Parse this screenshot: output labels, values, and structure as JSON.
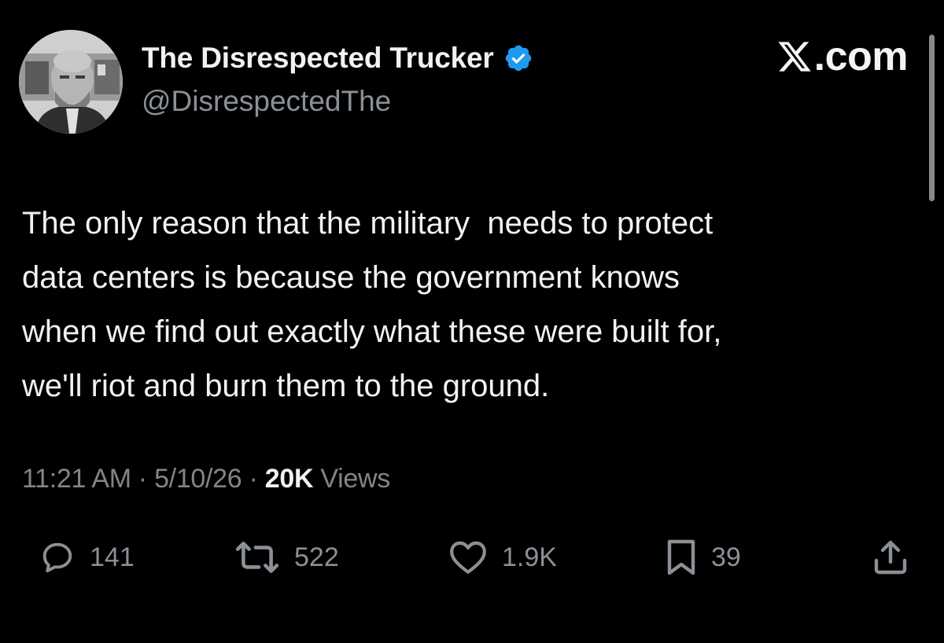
{
  "post": {
    "author": {
      "display_name": "The Disrespected Trucker",
      "handle": "@DisrespectedThe",
      "verified_color": "#1d9bf0",
      "avatar_icon": "profile-photo"
    },
    "site_logo_text": ".com",
    "text_lines": [
      "The only reason that the military  needs to protect",
      "data centers is because the government knows",
      "when we find out exactly what these were built for,",
      "we'll riot and burn them to the ground."
    ],
    "meta": {
      "time": "11:21 AM",
      "date": "5/10/26",
      "views_count": "20K",
      "views_label": "Views",
      "separator": "·"
    },
    "actions": {
      "reply_count": "141",
      "repost_count": "522",
      "like_count": "1.9K",
      "bookmark_count": "39"
    }
  },
  "colors": {
    "background": "#000000",
    "primary_text": "#e7e9ea",
    "secondary_text": "#8b9096",
    "accent": "#1d9bf0"
  }
}
